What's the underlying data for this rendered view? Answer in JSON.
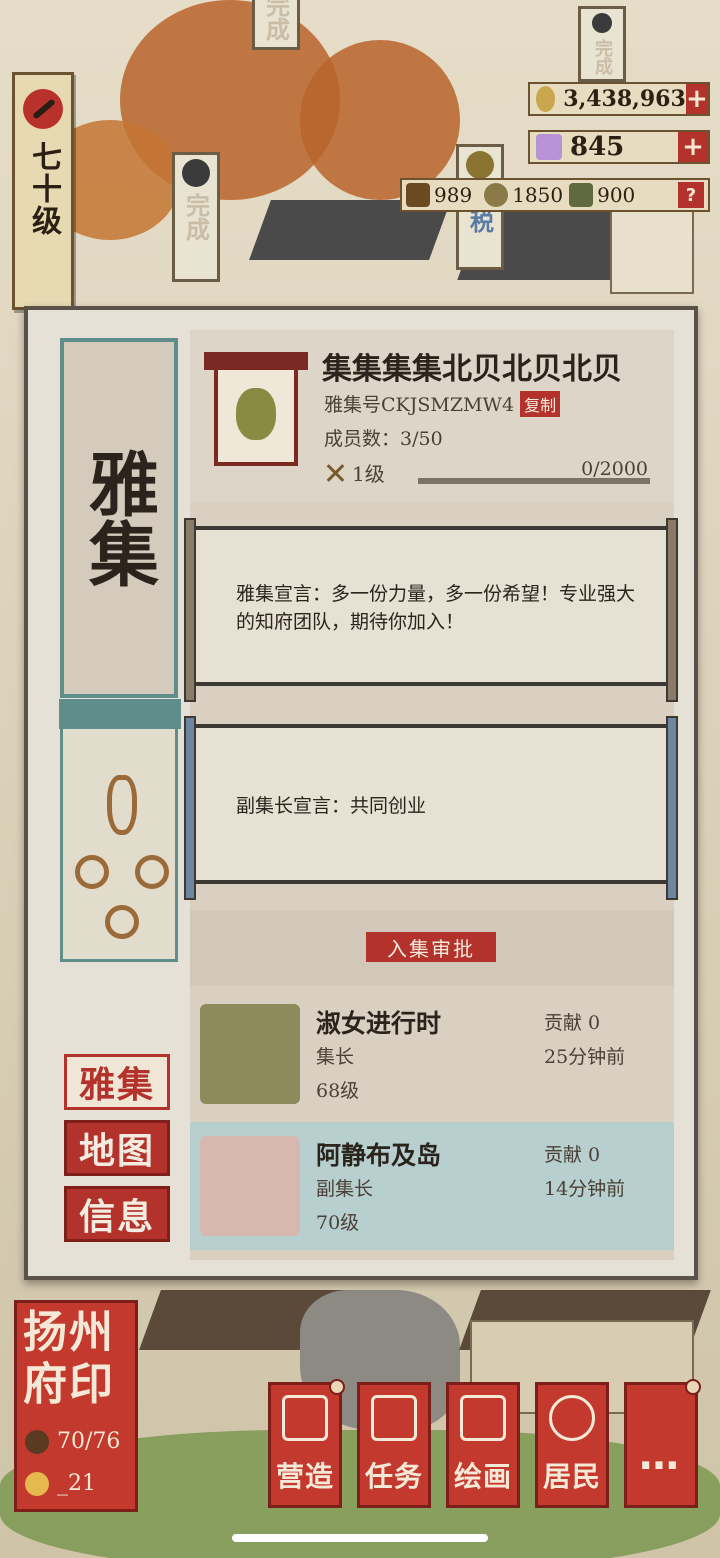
{
  "level_tag": {
    "text": "七十级",
    "icon": "brush-icon"
  },
  "signs": [
    {
      "text": "完成",
      "icon": "bell-icon"
    },
    {
      "text": "完成",
      "icon": "bell-icon"
    },
    {
      "text": "收税",
      "icon": "coin-icon"
    },
    {
      "text": "完成",
      "icon": "bell-icon"
    }
  ],
  "currencies": {
    "copper": {
      "value": "3,438,963",
      "icon": "copper-coin-icon",
      "plus": "+"
    },
    "jade": {
      "value": "845",
      "icon": "jade-gem-icon",
      "plus": "+"
    },
    "resources": [
      {
        "icon": "wood-icon",
        "value": "989"
      },
      {
        "icon": "stone-icon",
        "value": "1850"
      },
      {
        "icon": "tea-icon",
        "value": "900"
      }
    ],
    "help": "?"
  },
  "panel": {
    "side_title": "雅集",
    "nav": [
      {
        "label": "雅集",
        "active": true
      },
      {
        "label": "地图",
        "active": false
      },
      {
        "label": "信息",
        "active": false
      }
    ],
    "info": {
      "name": "集集集集北贝北贝北贝",
      "id_label": "雅集号CKJSMZMW4",
      "copy": "复制",
      "members": "成员数：3/50",
      "level": "1级",
      "progress_text": "0/2000",
      "progress_fraction": 0
    },
    "declaration": "雅集宣言：多一份力量，多一份希望！专业强大的知府团队，期待你加入！",
    "vice_declaration": "副集长宣言：共同创业",
    "approve": "入集审批",
    "members": [
      {
        "name": "淑女进行时",
        "role": "集长",
        "level": "68级",
        "contrib": "贡献 0",
        "time": "25分钟前"
      },
      {
        "name": "阿静布及岛",
        "role": "副集长",
        "level": "70级",
        "contrib": "贡献 0",
        "time": "14分钟前"
      }
    ]
  },
  "seal": {
    "title": "扬州府印",
    "pop": "70/76",
    "happy": "_21"
  },
  "actions": [
    {
      "label": "营造",
      "icon": "building-icon"
    },
    {
      "label": "任务",
      "icon": "scroll-task-icon"
    },
    {
      "label": "绘画",
      "icon": "painting-icon"
    },
    {
      "label": "居民",
      "icon": "resident-icon"
    },
    {
      "label": "…",
      "icon": "more-icon"
    }
  ]
}
